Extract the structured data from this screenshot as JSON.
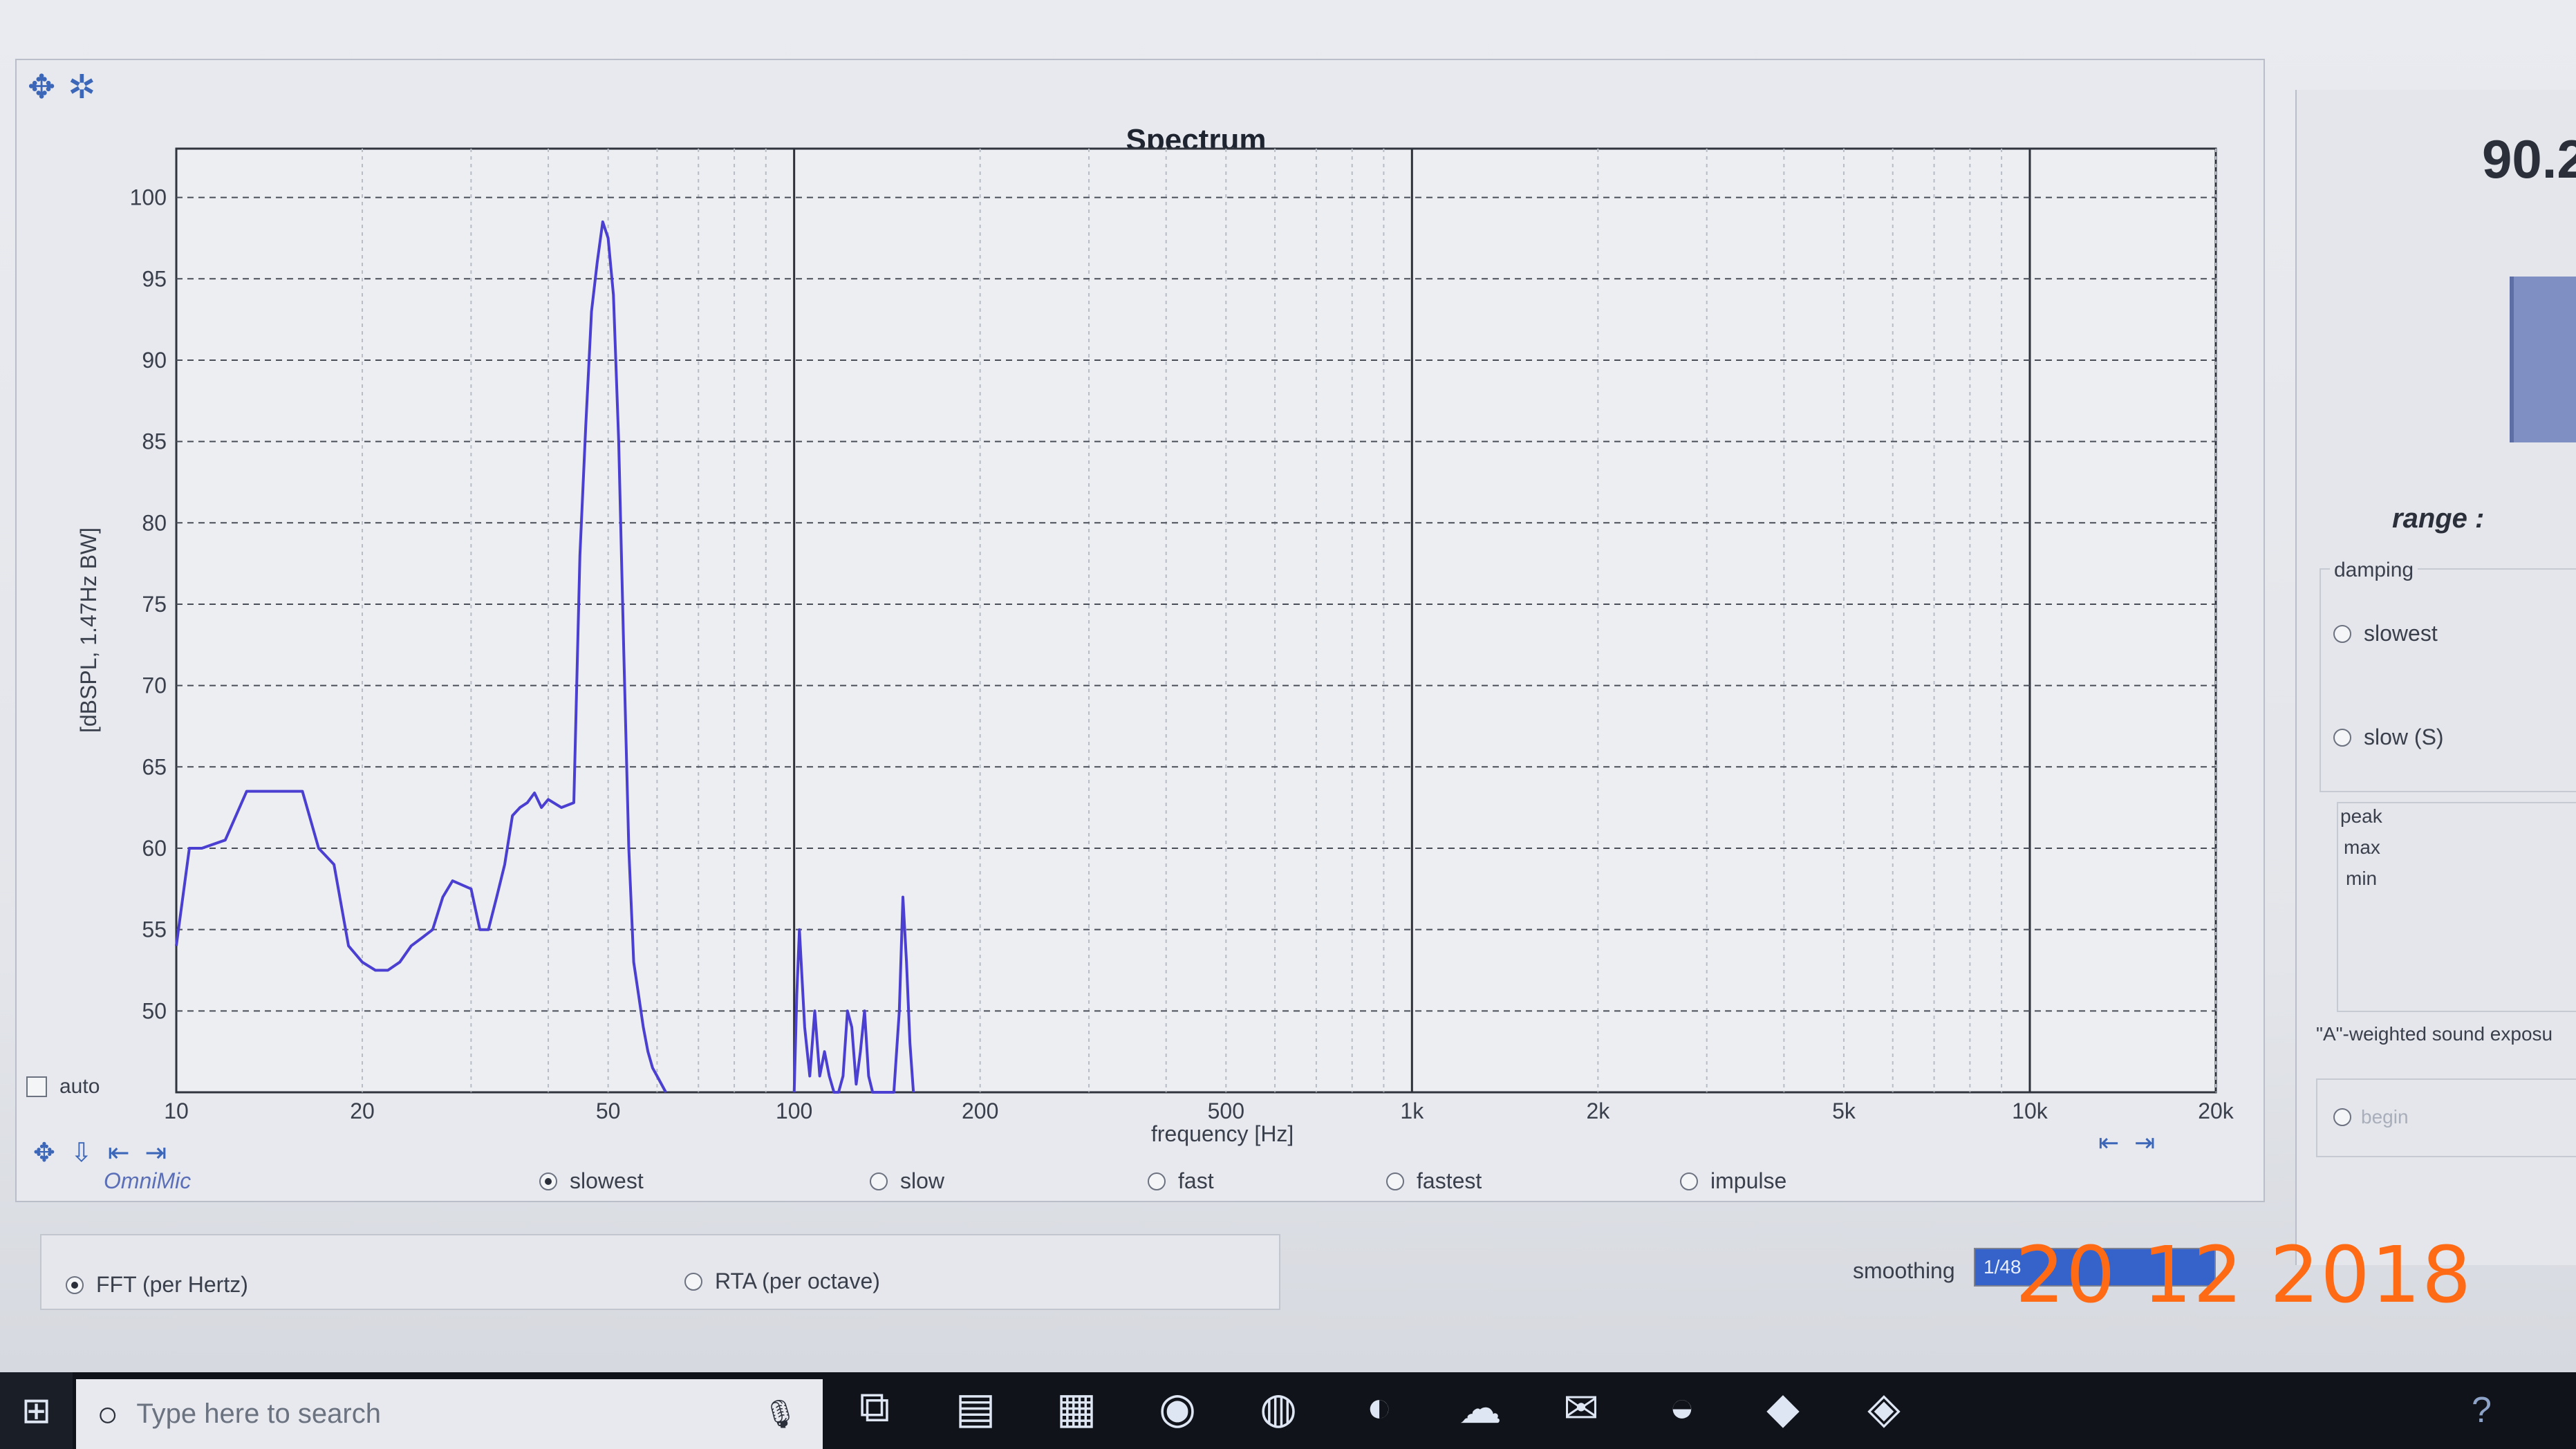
{
  "chart_title": "Spectrum",
  "chart_data": {
    "type": "line",
    "title": "Spectrum",
    "xlabel": "frequency [Hz]",
    "ylabel": "[dBSPL, 1.47Hz BW]",
    "x_scale": "log",
    "xlim": [
      10,
      20000
    ],
    "ylim": [
      45,
      103
    ],
    "x_ticks": [
      10,
      20,
      50,
      100,
      200,
      500,
      1000,
      2000,
      5000,
      10000,
      20000
    ],
    "x_tick_labels": [
      "10",
      "20",
      "50",
      "100",
      "200",
      "500",
      "1k",
      "2k",
      "5k",
      "10k",
      "20k"
    ],
    "y_ticks": [
      50,
      55,
      60,
      65,
      70,
      75,
      80,
      85,
      90,
      95,
      100
    ],
    "y_tick_labels": [
      "50",
      "55",
      "60",
      "65",
      "70",
      "75",
      "80",
      "85",
      "90",
      "95",
      "100"
    ],
    "grid": true,
    "line_color": "#4a3fd0",
    "series": [
      {
        "x": [
          10,
          10.5,
          11,
          12,
          13,
          14,
          15,
          16,
          17,
          18,
          19,
          20,
          21,
          22,
          23,
          24,
          25,
          26,
          27,
          28,
          30,
          31,
          32,
          33,
          34,
          35,
          36,
          37,
          38,
          39,
          40,
          42,
          44,
          45,
          46,
          47,
          48,
          49,
          50,
          51,
          52,
          53,
          54,
          55,
          56,
          57,
          58,
          59,
          60,
          62
        ],
        "y": [
          54,
          60,
          60,
          60.5,
          63.5,
          63.5,
          63.5,
          63.5,
          60,
          59,
          54,
          53,
          52.5,
          52.5,
          53,
          54,
          54.5,
          55,
          57,
          58,
          57.5,
          55,
          55,
          57,
          59,
          62,
          62.5,
          62.8,
          63.4,
          62.5,
          63,
          62.5,
          62.8,
          78,
          86,
          93,
          96,
          98.5,
          97.5,
          94,
          85,
          72,
          60,
          53,
          51,
          49,
          47.5,
          46.5,
          46,
          45
        ]
      },
      {
        "x": [
          100,
          101,
          102,
          103,
          104,
          106,
          108,
          110,
          112,
          114,
          116,
          118,
          120,
          122,
          124,
          126,
          128,
          130,
          132,
          134,
          136,
          138,
          140,
          145,
          148,
          150,
          152,
          154,
          156
        ],
        "y": [
          45,
          51,
          55,
          52,
          49,
          46,
          50,
          46,
          47.5,
          46,
          45,
          45,
          46,
          50,
          49,
          45.5,
          47.5,
          50,
          46,
          45,
          45,
          45,
          45,
          45,
          50,
          57,
          53,
          48,
          45
        ]
      }
    ]
  },
  "left_controls": {
    "auto_label": "auto",
    "scale_icons": [
      "up-arrow-icon",
      "down-arrow-icon",
      "shrink-h-icon",
      "expand-h-icon"
    ],
    "brand": "OmniMic"
  },
  "right_controls": {
    "scale_icons": [
      "shrink-h-icon",
      "expand-h-icon"
    ]
  },
  "damping_options": [
    {
      "label": "slowest",
      "selected": true
    },
    {
      "label": "slow",
      "selected": false
    },
    {
      "label": "fast",
      "selected": false
    },
    {
      "label": "fastest",
      "selected": false
    },
    {
      "label": "impulse",
      "selected": false
    }
  ],
  "analysis_mode": [
    {
      "label": "FFT (per Hertz)",
      "selected": true
    },
    {
      "label": "RTA (per octave)",
      "selected": false
    }
  ],
  "smoothing": {
    "label": "smoothing",
    "value": "1/48"
  },
  "date_stamp": "20  12  2018",
  "side_panel": {
    "reading": "90.2",
    "range_label": "range :",
    "damping_title": "damping",
    "damping_options": [
      {
        "label": "slowest",
        "selected": false
      },
      {
        "label": "slow (S)",
        "selected": false
      }
    ],
    "stats": [
      "peak",
      "max",
      "min"
    ],
    "a_weighted_label": "\"A\"-weighted sound exposu",
    "begin_label": "begin"
  },
  "taskbar": {
    "search_placeholder": "Type here to search",
    "apps": [
      "task-view-icon",
      "file-explorer-icon",
      "store-icon",
      "camera-icon",
      "hp-icon",
      "amazon-icon",
      "weather-icon",
      "mail-icon",
      "edge-icon",
      "acrobat-icon",
      "app-icon"
    ]
  },
  "colors": {
    "trace": "#4a3fd0",
    "date_stamp": "#ff6a14",
    "accent": "#3c66b8"
  }
}
